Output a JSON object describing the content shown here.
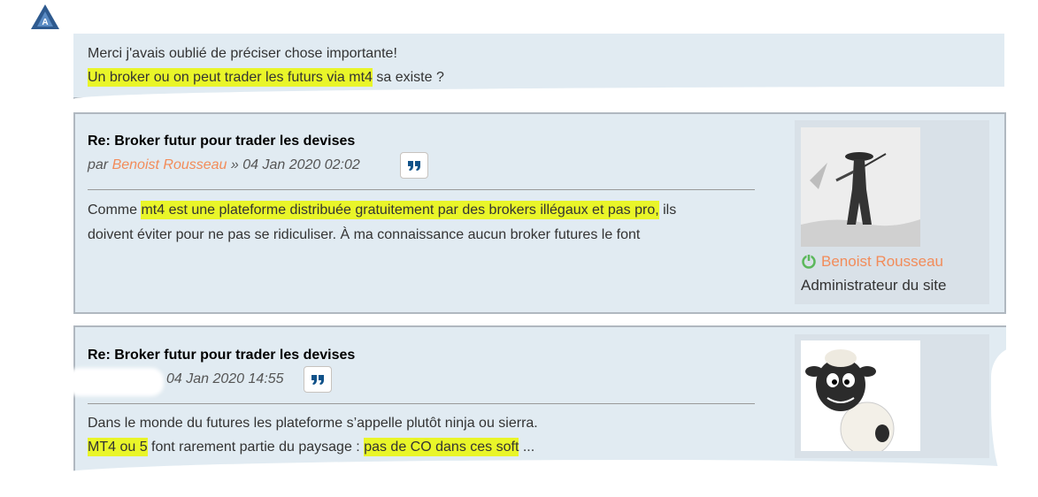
{
  "post1": {
    "line1": "Merci j'avais oublié de préciser chose importante!",
    "line2_highlight": "Un broker ou on peut trader les futurs via mt4",
    "line2_rest": " sa existe ?"
  },
  "post2": {
    "title": "Re: Broker futur pour trader les devises",
    "by_prefix": "par ",
    "author": "Benoist Rousseau",
    "date": " » 04 Jan 2020 02:02",
    "body_start": "Comme ",
    "body_highlight": "mt4 est une plateforme distribuée gratuitement par des brokers illégaux et pas pro,",
    "body_end": " ils",
    "body_line2": "doivent éviter pour ne pas se ridiculiser. À ma connaissance aucun broker futures le font",
    "profile_name": "Benoist Rousseau",
    "profile_rank": "Administrateur du site",
    "quote_icon": "quote-icon",
    "online_icon": "power-icon"
  },
  "post3": {
    "title": "Re: Broker futur pour trader les devises",
    "date": "04 Jan 2020 14:55",
    "line1": "Dans le monde du futures les plateforme s’appelle plutôt ninja ou sierra.",
    "line2_hl1": "MT4 ou 5",
    "line2_mid": " font rarement partie du paysage : ",
    "line2_hl2": "pas de CO dans ces soft",
    "line2_end": " ..."
  },
  "colors": {
    "post_bg": "#e1ebf2",
    "author": "#f28c5a",
    "highlight": "#e9f529",
    "quote": "#105289",
    "online": "#5cb85c"
  }
}
